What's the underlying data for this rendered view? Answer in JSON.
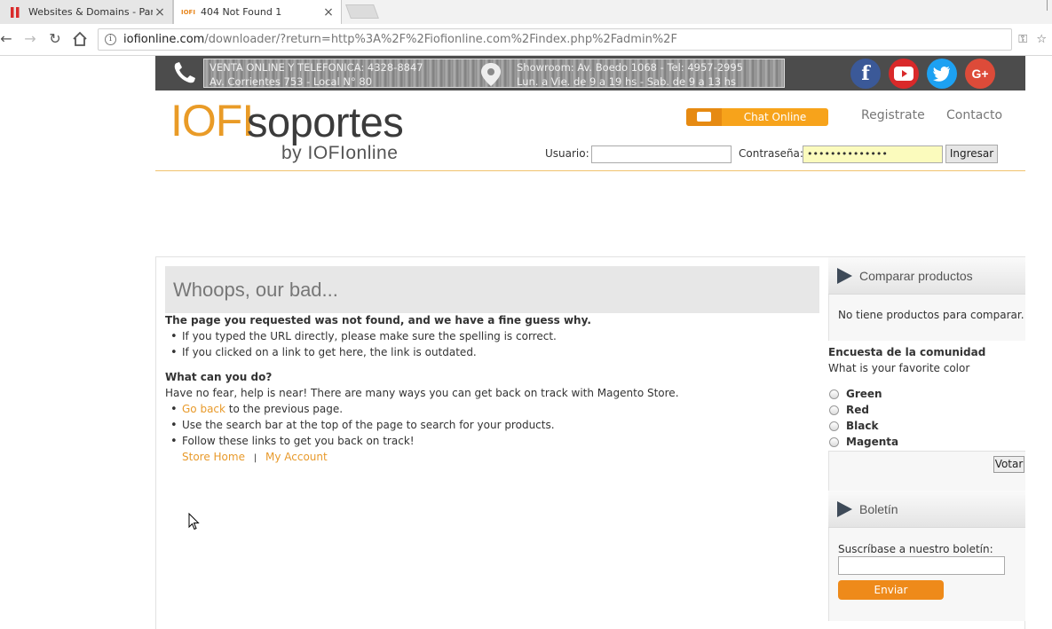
{
  "browser": {
    "tabs": [
      {
        "title": "Websites & Domains - Para",
        "active": false
      },
      {
        "title": "404 Not Found 1",
        "favicon_text": "IOFI",
        "active": true
      }
    ],
    "url_host": "iofionline.com",
    "url_path": "/downloader/?return=http%3A%2F%2Fiofionline.com%2Findex.php%2Fadmin%2F"
  },
  "header": {
    "contact_line1": "VENTA ONLINE Y TELEFONICA: 4328-8847",
    "contact_line2": "Av. Corrientes 753 - Local N° 80",
    "showroom_line1": "Showroom: Av. Boedo 1068 - Tel: 4957-2995",
    "showroom_line2": "Lun. a Vie. de 9 a 19 hs - Sab. de 9 a 13 hs",
    "social": [
      "f",
      "youtube",
      "twitter",
      "g+"
    ],
    "logo_main": "IOFI",
    "logo_sub": "soportes",
    "logo_by": "by IOFIonline",
    "chat_label": "Chat Online",
    "register_label": "Registrate",
    "contact_label": "Contacto",
    "user_label": "Usuario:",
    "password_label": "Contraseña:",
    "password_value": "••••••••••••••",
    "login_button": "Ingresar"
  },
  "main": {
    "title": "Whoops, our bad...",
    "heading1": "The page you requested was not found, and we have a fine guess why.",
    "reasons": [
      "If you typed the URL directly, please make sure the spelling is correct.",
      "If you clicked on a link to get here, the link is outdated."
    ],
    "heading2": "What can you do?",
    "help_text": "Have no fear, help is near! There are many ways you can get back on track with Magento Store.",
    "go_back_link": "Go back",
    "go_back_rest": " to the previous page.",
    "search_tip": "Use the search bar at the top of the page to search for your products.",
    "follow_tip": "Follow these links to get you back on track!",
    "store_home": "Store Home",
    "separator": "|",
    "my_account": "My Account"
  },
  "sidebar": {
    "compare_title": "Comparar productos",
    "compare_empty": "No tiene productos para comparar.",
    "poll_title": "Encuesta de la comunidad",
    "poll_question": "What is your favorite color",
    "poll_options": [
      "Green",
      "Red",
      "Black",
      "Magenta"
    ],
    "vote_button": "Votar",
    "newsletter_title": "Boletín",
    "newsletter_label": "Suscríbase a nuestro boletín:",
    "send_button": "Enviar"
  },
  "colors": {
    "accent": "#f7a31b",
    "link": "#e89a2b",
    "facebook": "#3b5998",
    "youtube": "#d9292a",
    "twitter": "#1da1f2",
    "googleplus": "#dd4b39"
  }
}
